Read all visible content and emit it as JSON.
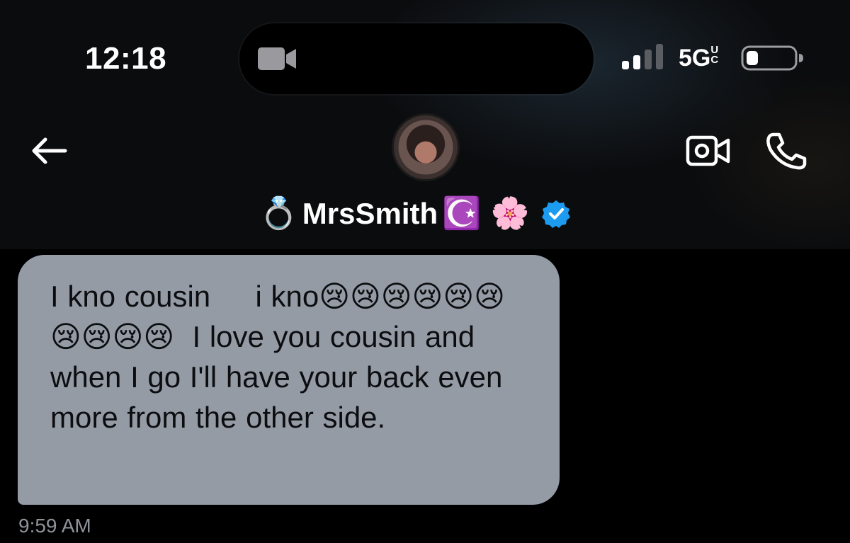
{
  "status_bar": {
    "time": "12:18",
    "network": "5G",
    "network_suffix": "UC",
    "icons": [
      "video-camera-icon",
      "signal-icon",
      "battery-icon"
    ]
  },
  "header": {
    "back_icon": "arrow-left-icon",
    "contact_name_prefix": "💍",
    "contact_name": "MrsSmith",
    "contact_name_suffix": "☪️ 🌸",
    "verified_icon": "verified-badge-icon",
    "video_call_icon": "video-call-icon",
    "phone_call_icon": "phone-icon",
    "accent_color": "#1d9bf0"
  },
  "messages": [
    {
      "text": "I kno cousin     i kno😢😢😢😢😢😢😢😢😢😢  I love you cousin and when I go I'll have your back even more from the other side.",
      "timestamp": "9:59 AM"
    }
  ],
  "colors": {
    "background": "#000000",
    "bubble": "#959ba5",
    "timestamp": "#8e939a"
  }
}
